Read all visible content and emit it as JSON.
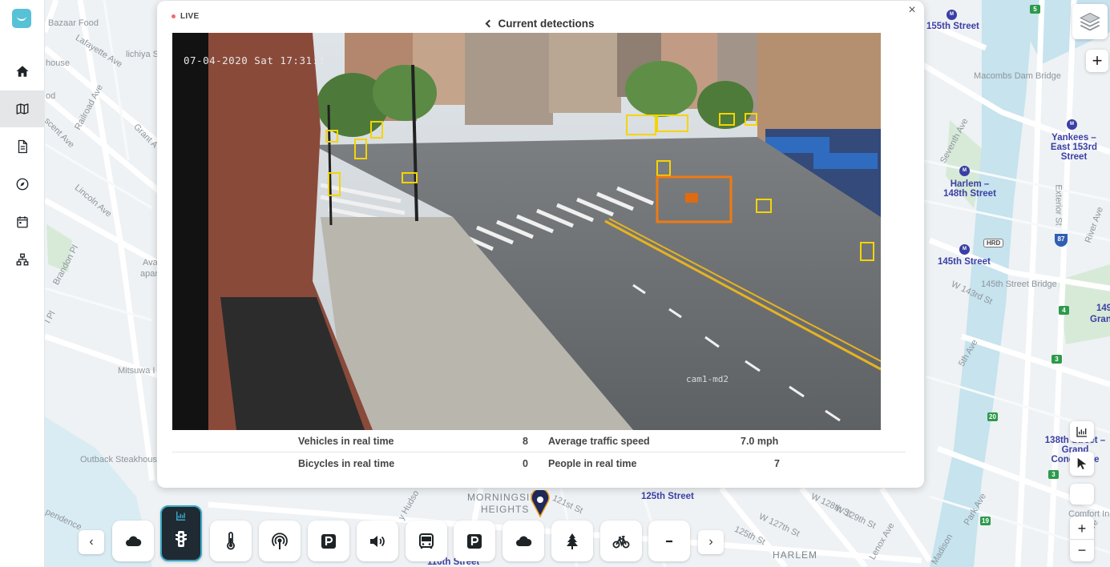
{
  "popup": {
    "live_label": "LIVE",
    "title": "Current detections",
    "close_label": "×",
    "camera": {
      "timestamp": "07-04-2020 Sat 17:31:1",
      "camera_id": "cam1-md2"
    },
    "stats": [
      {
        "label": "Vehicles in real time",
        "value": "8",
        "label2": "Average traffic speed",
        "value2": "7.0 mph"
      },
      {
        "label": "Bicycles in real time",
        "value": "0",
        "label2": "People in real time",
        "value2": "7"
      }
    ]
  },
  "map": {
    "labels": {
      "bazaar_food": "Bazaar Food",
      "lafayette_ave": "Lafayette Ave",
      "lichiya": "lichiya S",
      "house": "house",
      "od": "od",
      "railroad_ave": "Railroad Ave",
      "crescent_ave": "scent Ave",
      "grant_a": "Grant A",
      "lincoln_ave": "Lincoln Ave",
      "brandon_pl": "Brandon Pl",
      "ava_apar": "Ava",
      "apar": "apar",
      "pl": "l Pl",
      "mitsuwa": "Mitsuwa I",
      "outback": "Outback Steakhouse",
      "independence": "pendence",
      "morningside": "MORNINGSIDE",
      "heights": "HEIGHTS",
      "hudson": "y Hudso",
      "st121": "121st St",
      "st125": "125th Street",
      "st116": "116th Street",
      "w127": "W 127th St",
      "w129": "W 129th St",
      "w128": "W 128th St",
      "st125b": "125th St",
      "harlem": "HARLEM",
      "lenox": "Lenox Ave",
      "fifth_ave": "5th Ave",
      "park_ave": "Park Ave",
      "madison": "Madison",
      "third_ave": "3rd Ave",
      "st155": "155th Street",
      "macombs": "Macombs Dam Bridge",
      "yankees": "Yankees – East 153rd Street",
      "harlem148": "Harlem – 148th Street",
      "st145": "145th Street",
      "hrd": "HRD",
      "w143": "W 143rd St",
      "bridge145": "145th Street Bridge",
      "seventh_ave": "Seventh Ave",
      "exterior_st": "Exterior St",
      "river_ave": "River Ave",
      "st138": "138th Street – Grand Concourse",
      "gran149": "149",
      "gran": "Gran",
      "comfort": "Comfort Inn"
    },
    "route_shields": [
      "5",
      "4",
      "3",
      "20",
      "3",
      "19"
    ],
    "interstate": "87"
  },
  "toolbar": {
    "prev_label": "‹",
    "next_label": "›",
    "items": [
      {
        "name": "weather-cloud",
        "icon": "cloud-icon"
      },
      {
        "name": "traffic",
        "icon": "traffic-light-icon",
        "active": true
      },
      {
        "name": "temperature",
        "icon": "thermometer-icon"
      },
      {
        "name": "sensors",
        "icon": "broadcast-icon"
      },
      {
        "name": "parking",
        "icon": "parking-icon"
      },
      {
        "name": "noise",
        "icon": "speaker-icon"
      },
      {
        "name": "transit",
        "icon": "bus-icon"
      },
      {
        "name": "parking-2",
        "icon": "parking-icon"
      },
      {
        "name": "weather-cloud-2",
        "icon": "cloud-icon"
      },
      {
        "name": "trees",
        "icon": "tree-icon"
      },
      {
        "name": "bikes",
        "icon": "bicycle-icon"
      },
      {
        "name": "more",
        "icon": "minus-icon"
      }
    ]
  },
  "controls": {
    "zoom_in": "+",
    "zoom_out": "−",
    "zoom_in_top": "+"
  },
  "colors": {
    "accent": "#3aa7c4",
    "detection_box": "#f5a623",
    "selected_box": "#f07a10",
    "route_green": "#2d9a4b",
    "metro": "#3b3fa4"
  }
}
